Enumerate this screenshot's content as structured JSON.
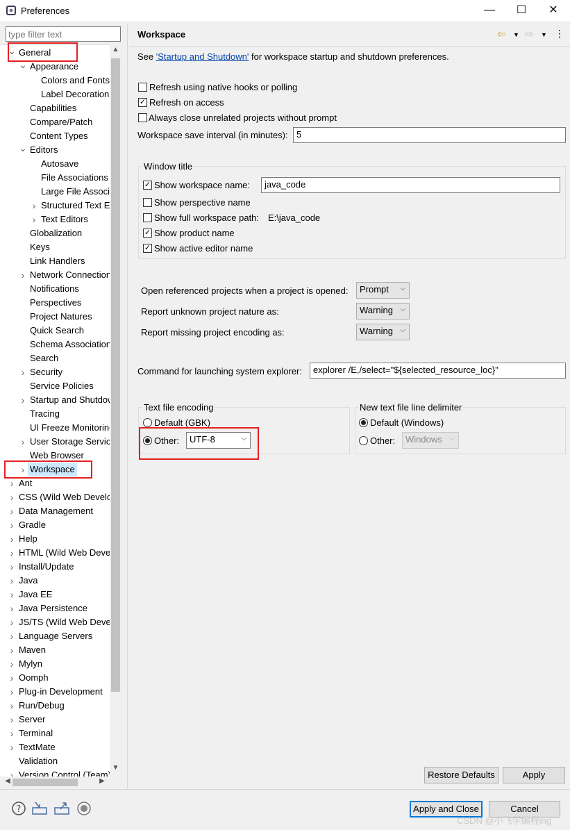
{
  "window": {
    "title": "Preferences",
    "min": "—",
    "max": "☐",
    "close": "✕"
  },
  "filter": {
    "placeholder": "type filter text"
  },
  "tree": [
    {
      "label": "General",
      "depth": 0,
      "expander": "open"
    },
    {
      "label": "Appearance",
      "depth": 1,
      "expander": "open"
    },
    {
      "label": "Colors and Fonts",
      "depth": 2,
      "expander": "none"
    },
    {
      "label": "Label Decorations",
      "depth": 2,
      "expander": "none"
    },
    {
      "label": "Capabilities",
      "depth": 1,
      "expander": "none"
    },
    {
      "label": "Compare/Patch",
      "depth": 1,
      "expander": "none"
    },
    {
      "label": "Content Types",
      "depth": 1,
      "expander": "none"
    },
    {
      "label": "Editors",
      "depth": 1,
      "expander": "open"
    },
    {
      "label": "Autosave",
      "depth": 2,
      "expander": "none"
    },
    {
      "label": "File Associations",
      "depth": 2,
      "expander": "none"
    },
    {
      "label": "Large File Associations",
      "depth": 2,
      "expander": "none"
    },
    {
      "label": "Structured Text Editors",
      "depth": 2,
      "expander": "closed"
    },
    {
      "label": "Text Editors",
      "depth": 2,
      "expander": "closed"
    },
    {
      "label": "Globalization",
      "depth": 1,
      "expander": "none"
    },
    {
      "label": "Keys",
      "depth": 1,
      "expander": "none"
    },
    {
      "label": "Link Handlers",
      "depth": 1,
      "expander": "none"
    },
    {
      "label": "Network Connections",
      "depth": 1,
      "expander": "closed"
    },
    {
      "label": "Notifications",
      "depth": 1,
      "expander": "none"
    },
    {
      "label": "Perspectives",
      "depth": 1,
      "expander": "none"
    },
    {
      "label": "Project Natures",
      "depth": 1,
      "expander": "none"
    },
    {
      "label": "Quick Search",
      "depth": 1,
      "expander": "none"
    },
    {
      "label": "Schema Associations",
      "depth": 1,
      "expander": "none"
    },
    {
      "label": "Search",
      "depth": 1,
      "expander": "none"
    },
    {
      "label": "Security",
      "depth": 1,
      "expander": "closed"
    },
    {
      "label": "Service Policies",
      "depth": 1,
      "expander": "none"
    },
    {
      "label": "Startup and Shutdown",
      "depth": 1,
      "expander": "closed"
    },
    {
      "label": "Tracing",
      "depth": 1,
      "expander": "none"
    },
    {
      "label": "UI Freeze Monitoring",
      "depth": 1,
      "expander": "none"
    },
    {
      "label": "User Storage Service",
      "depth": 1,
      "expander": "closed"
    },
    {
      "label": "Web Browser",
      "depth": 1,
      "expander": "none"
    },
    {
      "label": "Workspace",
      "depth": 1,
      "expander": "closed",
      "selected": true
    },
    {
      "label": "Ant",
      "depth": 0,
      "expander": "closed"
    },
    {
      "label": "CSS (Wild Web Developer)",
      "depth": 0,
      "expander": "closed"
    },
    {
      "label": "Data Management",
      "depth": 0,
      "expander": "closed"
    },
    {
      "label": "Gradle",
      "depth": 0,
      "expander": "closed"
    },
    {
      "label": "Help",
      "depth": 0,
      "expander": "closed"
    },
    {
      "label": "HTML (Wild Web Developer)",
      "depth": 0,
      "expander": "closed"
    },
    {
      "label": "Install/Update",
      "depth": 0,
      "expander": "closed"
    },
    {
      "label": "Java",
      "depth": 0,
      "expander": "closed"
    },
    {
      "label": "Java EE",
      "depth": 0,
      "expander": "closed"
    },
    {
      "label": "Java Persistence",
      "depth": 0,
      "expander": "closed"
    },
    {
      "label": "JS/TS (Wild Web Developer)",
      "depth": 0,
      "expander": "closed"
    },
    {
      "label": "Language Servers",
      "depth": 0,
      "expander": "closed"
    },
    {
      "label": "Maven",
      "depth": 0,
      "expander": "closed"
    },
    {
      "label": "Mylyn",
      "depth": 0,
      "expander": "closed"
    },
    {
      "label": "Oomph",
      "depth": 0,
      "expander": "closed"
    },
    {
      "label": "Plug-in Development",
      "depth": 0,
      "expander": "closed"
    },
    {
      "label": "Run/Debug",
      "depth": 0,
      "expander": "closed"
    },
    {
      "label": "Server",
      "depth": 0,
      "expander": "closed"
    },
    {
      "label": "Terminal",
      "depth": 0,
      "expander": "closed"
    },
    {
      "label": "TextMate",
      "depth": 0,
      "expander": "closed"
    },
    {
      "label": "Validation",
      "depth": 0,
      "expander": "none"
    },
    {
      "label": "Version Control (Team)",
      "depth": 0,
      "expander": "closed"
    }
  ],
  "page": {
    "title": "Workspace",
    "intro_see": "See",
    "intro_link": "'Startup and Shutdown'",
    "intro_rest": "for workspace startup and shutdown preferences.",
    "refresh_native": {
      "label": "Refresh using native hooks or polling",
      "checked": false
    },
    "refresh_access": {
      "label": "Refresh on access",
      "checked": true
    },
    "always_close": {
      "label": "Always close unrelated projects without prompt",
      "checked": false
    },
    "save_interval_label": "Workspace save interval (in minutes):",
    "save_interval_value": "5",
    "window_title": {
      "legend": "Window title",
      "show_workspace_name": {
        "label": "Show workspace name:",
        "checked": true,
        "value": "java_code"
      },
      "show_perspective": {
        "label": "Show perspective name",
        "checked": false
      },
      "show_full_path": {
        "label": "Show full workspace path:",
        "checked": false,
        "value": "E:\\java_code"
      },
      "show_product": {
        "label": "Show product name",
        "checked": true
      },
      "show_active_editor": {
        "label": "Show active editor name",
        "checked": true
      }
    },
    "open_referenced": {
      "label": "Open referenced projects when a project is opened:",
      "value": "Prompt"
    },
    "unknown_nature": {
      "label": "Report unknown project nature as:",
      "value": "Warning"
    },
    "missing_encoding": {
      "label": "Report missing project encoding as:",
      "value": "Warning"
    },
    "explorer_cmd": {
      "label": "Command for launching system explorer:",
      "value": "explorer /E,/select=\"${selected_resource_loc}\""
    },
    "encoding": {
      "legend": "Text file encoding",
      "default_label": "Default (GBK)",
      "other_label": "Other:",
      "other_value": "UTF-8",
      "selected": "other"
    },
    "delimiter": {
      "legend": "New text file line delimiter",
      "default_label": "Default (Windows)",
      "other_label": "Other:",
      "other_value": "Windows",
      "selected": "default"
    },
    "restore_defaults": "Restore Defaults",
    "apply": "Apply"
  },
  "footer": {
    "apply_close": "Apply and Close",
    "cancel": "Cancel",
    "icons": [
      "help-icon",
      "import-icon",
      "export-icon",
      "record-icon"
    ]
  },
  "watermark": "CSDN @小飞学编程ing",
  "colors": {
    "highlight": "#e52020",
    "selection": "#cce8ff",
    "link": "#0645ad",
    "default_button_border": "#0078d7"
  }
}
